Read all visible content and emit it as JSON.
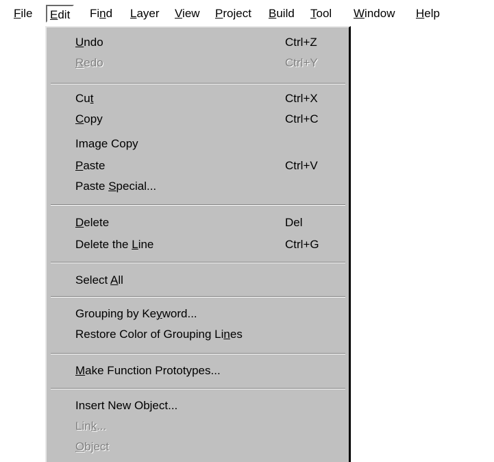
{
  "menubar": {
    "items": [
      {
        "before": "",
        "key": "F",
        "after": "ile"
      },
      {
        "before": "",
        "key": "E",
        "after": "dit"
      },
      {
        "before": "Fi",
        "key": "n",
        "after": "d"
      },
      {
        "before": "",
        "key": "L",
        "after": "ayer"
      },
      {
        "before": "",
        "key": "V",
        "after": "iew"
      },
      {
        "before": "",
        "key": "P",
        "after": "roject"
      },
      {
        "before": "",
        "key": "B",
        "after": "uild"
      },
      {
        "before": "",
        "key": "T",
        "after": "ool"
      },
      {
        "before": "",
        "key": "W",
        "after": "indow"
      },
      {
        "before": "",
        "key": "H",
        "after": "elp"
      }
    ]
  },
  "edit_menu": {
    "items": [
      {
        "before": "",
        "key": "U",
        "after": "ndo",
        "shortcut": "Ctrl+Z"
      },
      {
        "before": "",
        "key": "R",
        "after": "edo",
        "shortcut": "Ctrl+Y"
      },
      {
        "before": "Cu",
        "key": "t",
        "after": "",
        "shortcut": "Ctrl+X"
      },
      {
        "before": "",
        "key": "C",
        "after": "opy",
        "shortcut": "Ctrl+C"
      },
      {
        "before": "Ima",
        "key": "g",
        "after": "e Copy",
        "shortcut": ""
      },
      {
        "before": "",
        "key": "P",
        "after": "aste",
        "shortcut": "Ctrl+V"
      },
      {
        "before": "Paste ",
        "key": "S",
        "after": "pecial...",
        "shortcut": ""
      },
      {
        "before": "",
        "key": "D",
        "after": "elete",
        "shortcut": "Del"
      },
      {
        "before": "Delete the ",
        "key": "L",
        "after": "ine",
        "shortcut": "Ctrl+G"
      },
      {
        "before": "Select ",
        "key": "A",
        "after": "ll",
        "shortcut": ""
      },
      {
        "before": "Grouping by Ke",
        "key": "y",
        "after": "word...",
        "shortcut": ""
      },
      {
        "before": "Restore Color of Grouping Li",
        "key": "n",
        "after": "es",
        "shortcut": ""
      },
      {
        "before": "",
        "key": "M",
        "after": "ake Function Prototypes...",
        "shortcut": ""
      },
      {
        "before": "Insert New Object...",
        "key": "",
        "after": "",
        "shortcut": ""
      },
      {
        "before": "Lin",
        "key": "k",
        "after": "...",
        "shortcut": ""
      },
      {
        "before": "",
        "key": "O",
        "after": "bject",
        "shortcut": ""
      }
    ]
  }
}
